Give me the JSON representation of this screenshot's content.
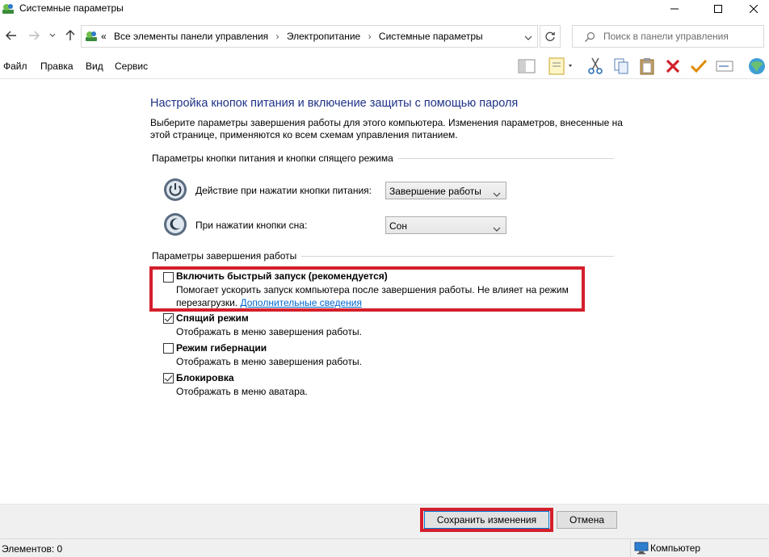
{
  "window": {
    "title": "Системные параметры"
  },
  "address": {
    "prefix": "«",
    "crumbs": [
      "Все элементы панели управления",
      "Электропитание",
      "Системные параметры"
    ],
    "search_placeholder": "Поиск в панели управления"
  },
  "menu": {
    "file": "Файл",
    "edit": "Правка",
    "view": "Вид",
    "service": "Сервис"
  },
  "page": {
    "title": "Настройка кнопок питания и включение защиты с помощью пароля",
    "description": "Выберите параметры завершения работы для этого компьютера. Изменения параметров, внесенные на этой странице, применяются ко всем схемам управления питанием.",
    "power_group": {
      "header": "Параметры кнопки питания и кнопки спящего режима",
      "power_button_label": "Действие при нажатии кнопки питания:",
      "power_button_value": "Завершение работы",
      "sleep_button_label": "При нажатии кнопки сна:",
      "sleep_button_value": "Сон"
    },
    "shutdown_group": {
      "header": "Параметры завершения работы",
      "options": [
        {
          "title": "Включить быстрый запуск (рекомендуется)",
          "desc": "Помогает ускорить запуск компьютера после завершения работы. Не влияет на режим",
          "desc2": "перезагрузки.",
          "link": "Дополнительные сведения",
          "checked": false
        },
        {
          "title": "Спящий режим",
          "desc": "Отображать в меню завершения работы.",
          "checked": true
        },
        {
          "title": "Режим гибернации",
          "desc": "Отображать в меню завершения работы.",
          "checked": false
        },
        {
          "title": "Блокировка",
          "desc": "Отображать в меню аватара.",
          "checked": true
        }
      ]
    }
  },
  "buttons": {
    "save": "Сохранить изменения",
    "cancel": "Отмена"
  },
  "status": {
    "items": "Элементов: 0",
    "location": "Компьютер"
  },
  "colors": {
    "title_blue": "#1e3287",
    "highlight_red": "#d41f2c",
    "link_blue": "#0066cc"
  }
}
